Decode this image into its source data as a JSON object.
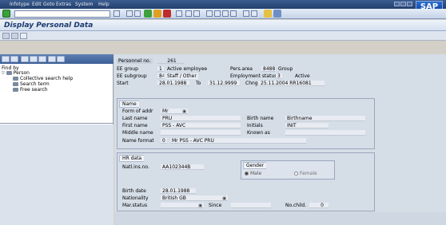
{
  "menu": {
    "items": [
      "Infotype",
      "Edit",
      "Goto",
      "Extras",
      "System",
      "Help"
    ]
  },
  "logo": "SAP",
  "title": "Display Personal Data",
  "left_panel": {
    "find_by": "Find by",
    "tree": [
      "Person",
      "Collective search help",
      "Search term",
      "Free search"
    ]
  },
  "header": {
    "personnel_no_label": "Personnel no.",
    "personnel_no": "261",
    "ee_group_label": "EE group",
    "ee_group_code": "1",
    "ee_group_text": "Active employee",
    "pers_area_label": "Pers.area",
    "pers_area_code": "8488",
    "pers_area_text": "Group",
    "ee_subgroup_label": "EE subgroup",
    "ee_subgroup_code": "84",
    "ee_subgroup_text": "Staff / Other",
    "emp_status_label": "Employment status",
    "emp_status_code": "3",
    "emp_status_text": "Active",
    "start_label": "Start",
    "start": "28.01.1988",
    "to_label": "To",
    "end": "31.12.9999",
    "chng_label": "Chng",
    "chng": "25.11.2004 RR16081"
  },
  "name_group": {
    "title": "Name",
    "form_of_addr_label": "Form of addr",
    "form_of_addr": "Mr",
    "last_name_label": "Last name",
    "last_name": "PRU",
    "birth_name_label": "Birth name",
    "birth_name": "Birthname",
    "first_name_label": "First name",
    "first_name": "PSS - AVC",
    "initials_label": "Initials",
    "initials": "INIT",
    "middle_name_label": "Middle name",
    "middle_name": "",
    "known_as_label": "Known as",
    "known_as": "",
    "name_format_label": "Name format",
    "name_format_code": "0",
    "name_format_text": "Mr PSS - AVC PRU"
  },
  "hr_group": {
    "title": "HR data",
    "natl_ins_label": "Natl.ins.no.",
    "natl_ins": "AA102344B",
    "gender_title": "Gender",
    "gender_male": "Male",
    "gender_female": "Female",
    "gender_selected": "Male",
    "birth_date_label": "Birth date",
    "birth_date": "28.01.1988",
    "nationality_label": "Nationality",
    "nationality": "British GB",
    "mar_status_label": "Mar.status",
    "mar_status": "",
    "since_label": "Since",
    "since": "",
    "no_child_label": "No.child.",
    "no_child": "0"
  },
  "colors": {
    "menubar": "#2e4d7e",
    "accent": "#1c3a6d",
    "panel_bg": "#d5dde7"
  }
}
